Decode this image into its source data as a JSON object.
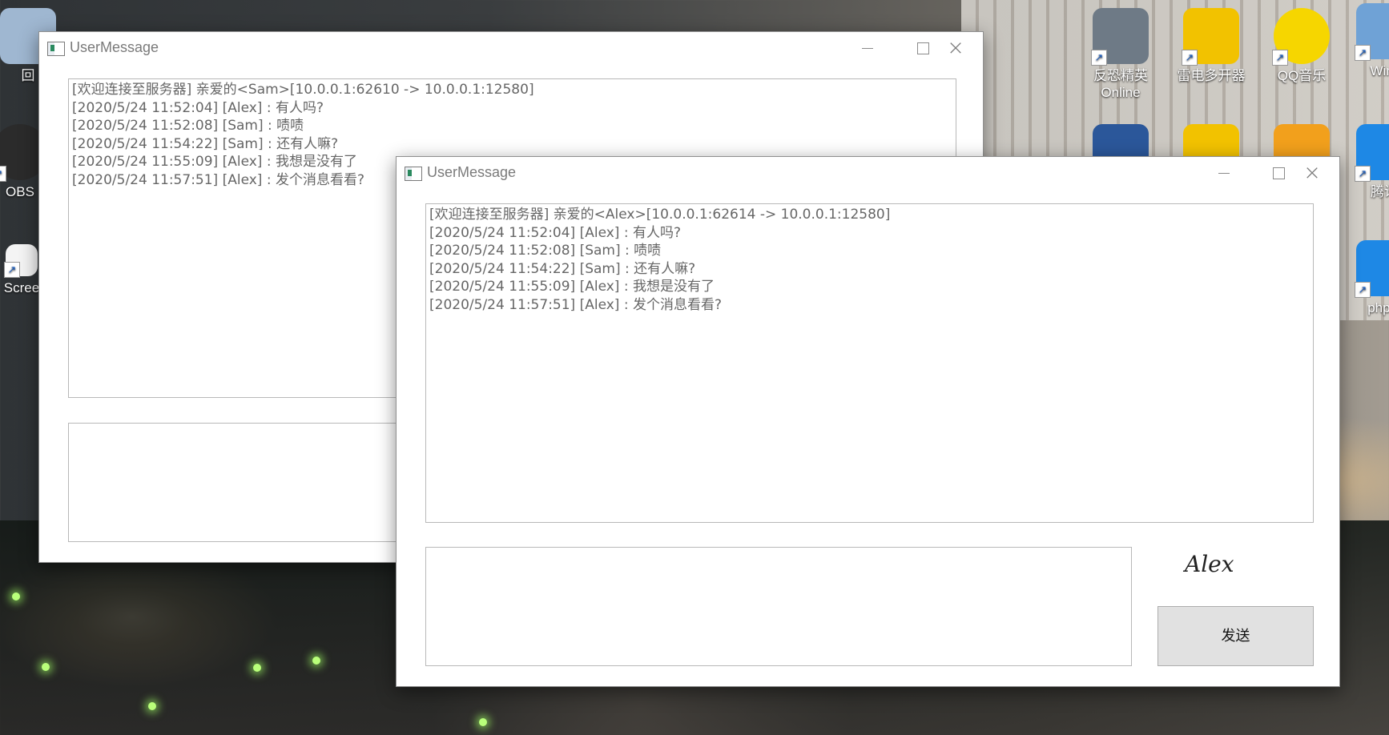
{
  "desktop": {
    "icons": [
      {
        "name": "recycle-bin",
        "label": "回",
        "color": "#9fb7d1"
      },
      {
        "name": "obs",
        "label": "OBS",
        "color": "#2b2b2b"
      },
      {
        "name": "screen",
        "label": "Scree",
        "color": "#f4f4f4"
      },
      {
        "name": "csgo",
        "label": "反恐精英 Online",
        "color": "#6e7a86"
      },
      {
        "name": "leidian",
        "label": "雷电多开器",
        "color": "#f2c200"
      },
      {
        "name": "qqmusic",
        "label": "QQ音乐",
        "color": "#f6d600"
      },
      {
        "name": "wire",
        "label": "Wire",
        "color": "#6fa2d6"
      },
      {
        "name": "word",
        "label": "",
        "color": "#2b579a"
      },
      {
        "name": "thunder",
        "label": "",
        "color": "#f2c200"
      },
      {
        "name": "orange-app",
        "label": "",
        "color": "#f2a01c"
      },
      {
        "name": "tencent",
        "label": "腾讯",
        "color": "#1e88e5"
      },
      {
        "name": "phpstorm",
        "label": "phpst",
        "color": "#1e88e5"
      }
    ]
  },
  "window_sam": {
    "title": "UserMessage",
    "messages": [
      "[欢迎连接至服务器] 亲爱的<Sam>[10.0.0.1:62610 -> 10.0.0.1:12580]",
      "[2020/5/24 11:52:04] [Alex] : 有人吗?",
      "[2020/5/24 11:52:08] [Sam] : 啧啧",
      "[2020/5/24 11:54:22] [Sam] : 还有人嘛?",
      "[2020/5/24 11:55:09] [Alex] : 我想是没有了",
      "[2020/5/24 11:57:51] [Alex] : 发个消息看看?"
    ],
    "input_value": ""
  },
  "window_alex": {
    "title": "UserMessage",
    "messages": [
      "[欢迎连接至服务器] 亲爱的<Alex>[10.0.0.1:62614 -> 10.0.0.1:12580]",
      "[2020/5/24 11:52:04] [Alex] : 有人吗?",
      "[2020/5/24 11:52:08] [Sam] : 啧啧",
      "[2020/5/24 11:54:22] [Sam] : 还有人嘛?",
      "[2020/5/24 11:55:09] [Alex] : 我想是没有了",
      "[2020/5/24 11:57:51] [Alex] : 发个消息看看?"
    ],
    "input_value": "",
    "username": "Alex",
    "send_label": "发送"
  },
  "colors": {
    "window_bg": "#ffffff",
    "text_gray": "#666666",
    "button_bg": "#e1e1e1"
  }
}
